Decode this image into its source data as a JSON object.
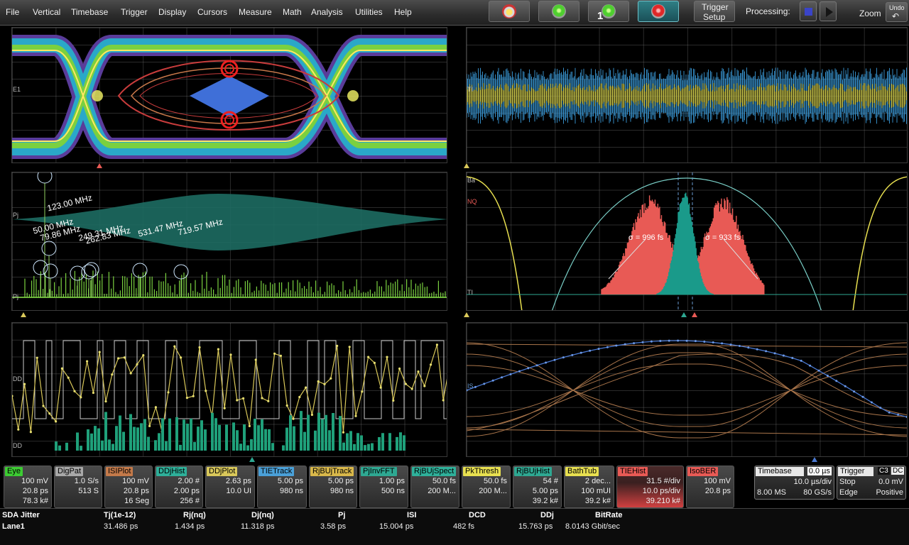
{
  "menu": [
    "File",
    "Vertical",
    "Timebase",
    "Trigger",
    "Display",
    "Cursors",
    "Measure",
    "Math",
    "Analysis",
    "Utilities",
    "Help"
  ],
  "toolbar": {
    "single_label": "1",
    "trigger_setup_line1": "Trigger",
    "trigger_setup_line2": "Setup",
    "processing_label": "Processing:",
    "zoom_label": "Zoom",
    "undo_label": "Undo"
  },
  "grid_labels": {
    "eye": "E1",
    "tie": "TI",
    "fft_top": "Pj",
    "fft_bottom": "Pj",
    "bath_top": "Ba",
    "bath_mid": "NQ",
    "bath_bottom": "TI",
    "ddj_top": "DD",
    "ddj_bottom": "DD",
    "isi": "IS"
  },
  "fft_peaks": [
    {
      "freq": "123.00 MHz"
    },
    {
      "freq": "50.00 MHz"
    },
    {
      "freq": "79.86 MHz"
    },
    {
      "freq": "249.31 MHz"
    },
    {
      "freq": "262.83 MHz"
    },
    {
      "freq": "531.47 MHz"
    },
    {
      "freq": "719.57 MHz"
    }
  ],
  "sigma_labels": {
    "left": "σ = 996 fs",
    "right": "σ = 933 fs"
  },
  "colors": {
    "eye": "#3dcc33",
    "digpat": "#a8a8a8",
    "isiplot": "#c47a4a",
    "ddjhist": "#2eb09a",
    "ddjplot": "#d9c85a",
    "tietrack": "#4aa0d8",
    "rjbujtrack": "#d9b84a",
    "pjinvfft": "#2ea892",
    "rjbujspect": "#2eb09a",
    "pkthresh": "#e8e050",
    "rjbujhist": "#2ea892",
    "bathtub": "#e8e050",
    "tiehist": "#e85a55",
    "isober": "#e85a55"
  },
  "descriptors": [
    {
      "name": "Eye",
      "values": [
        "100 mV",
        "20.8 ps",
        "78.3 k#"
      ]
    },
    {
      "name": "DigPat",
      "values": [
        "1.0 S/s",
        "513 S",
        ""
      ]
    },
    {
      "name": "ISIPlot",
      "values": [
        "100 mV",
        "20.8 ps",
        "16 Seg"
      ]
    },
    {
      "name": "DDjHist",
      "values": [
        "2.00 #",
        "2.00 ps",
        "256 #"
      ]
    },
    {
      "name": "DDjPlot",
      "values": [
        "2.63 ps",
        "10.0 UI",
        ""
      ]
    },
    {
      "name": "TIETrack",
      "values": [
        "5.00 ps",
        "980 ns",
        ""
      ]
    },
    {
      "name": "RjBUjTrack",
      "values": [
        "5.00 ps",
        "980 ns",
        ""
      ]
    },
    {
      "name": "PjInvFFT",
      "values": [
        "1.00 ps",
        "500 ns",
        ""
      ]
    },
    {
      "name": "RjBUjSpect",
      "values": [
        "50.0 fs",
        "200 M...",
        ""
      ]
    },
    {
      "name": "PkThresh",
      "values": [
        "50.0 fs",
        "200 M...",
        ""
      ]
    },
    {
      "name": "RjBUjHist",
      "values": [
        "54 #",
        "5.00 ps",
        "39.2 k#"
      ]
    },
    {
      "name": "BathTub",
      "values": [
        "2 dec...",
        "100 mUI",
        "39.2 k#"
      ]
    },
    {
      "name": "TIEHist",
      "values": [
        "31.5 #/div",
        "10.0 ps/div",
        "39.210 k#"
      ]
    },
    {
      "name": "IsoBER",
      "values": [
        "100 mV",
        "20.8 ps",
        ""
      ]
    }
  ],
  "timebase": {
    "title": "Timebase",
    "offset": "0.0 µs",
    "per_div": "10.0 µs/div",
    "samples": "8.00 MS",
    "rate": "80 GS/s"
  },
  "trigger": {
    "title": "Trigger",
    "source": "C3",
    "coupling": "DC",
    "mode": "Stop",
    "level": "0.0 mV",
    "type": "Edge",
    "slope": "Positive"
  },
  "status": {
    "title": "SDA Jitter",
    "lane": "Lane1",
    "headers": [
      "Tj(1e-12)",
      "Rj(nq)",
      "Dj(nq)",
      "Pj",
      "ISI",
      "DCD",
      "DDj",
      "BitRate"
    ],
    "values": [
      "31.486 ps",
      "1.434 ps",
      "11.318 ps",
      "3.58 ps",
      "15.004 ps",
      "482 fs",
      "15.763 ps",
      "8.0143 Gbit/sec"
    ]
  }
}
